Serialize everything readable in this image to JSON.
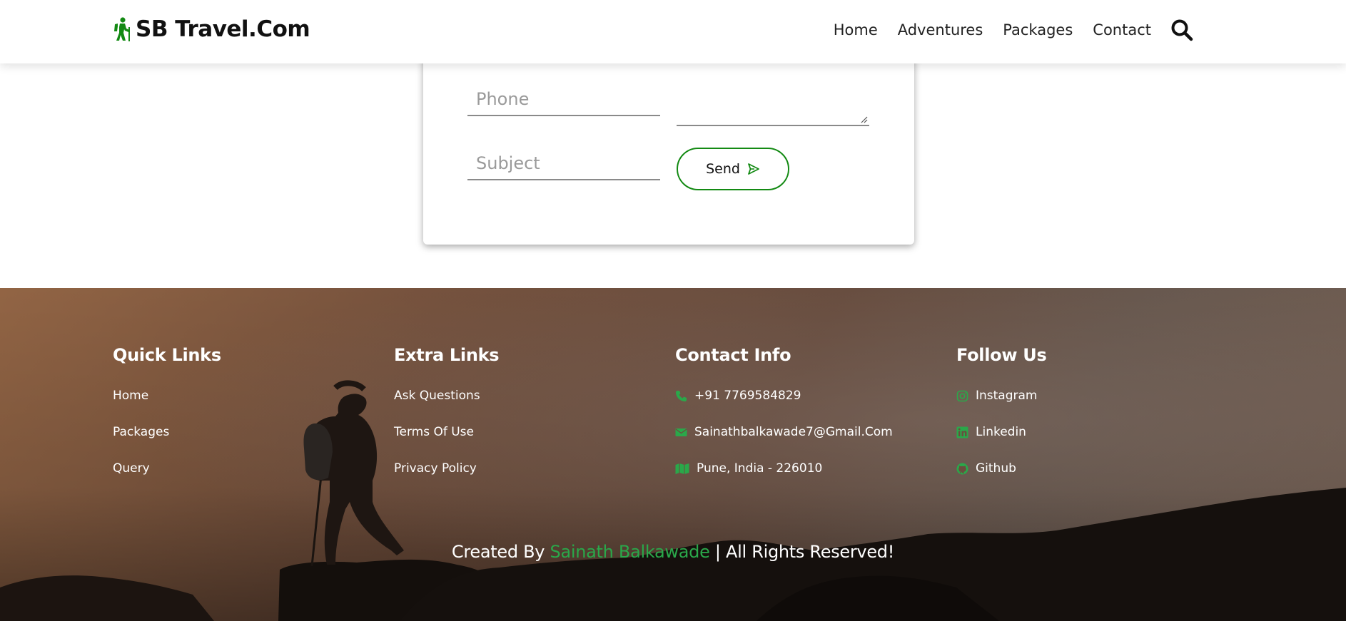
{
  "colors": {
    "brand_green": "#138a13",
    "accent_green": "#2aa84a",
    "text_dark": "#111111",
    "footer_text": "#ffffff"
  },
  "header": {
    "logo_icon": "hiker-icon",
    "logo_text": "SB Travel.Com",
    "nav": [
      "Home",
      "Adventures",
      "Packages",
      "Contact"
    ],
    "search_icon": "search-icon"
  },
  "form": {
    "phone_placeholder": "Phone",
    "subject_placeholder": "Subject",
    "message_value": "",
    "send_label": "Send",
    "send_icon": "paper-plane-icon"
  },
  "footer": {
    "quick_links": {
      "title": "Quick Links",
      "items": [
        "Home",
        "Packages",
        "Query"
      ]
    },
    "extra_links": {
      "title": "Extra Links",
      "items": [
        "Ask Questions",
        "Terms Of Use",
        "Privacy Policy"
      ]
    },
    "contact_info": {
      "title": "Contact Info",
      "items": [
        {
          "icon": "phone-icon",
          "text": "+91 7769584829"
        },
        {
          "icon": "envelope-icon",
          "text": "Sainathbalkawade7@Gmail.Com"
        },
        {
          "icon": "map-icon",
          "text": "Pune, India - 226010"
        }
      ]
    },
    "follow_us": {
      "title": "Follow Us",
      "items": [
        {
          "icon": "instagram-icon",
          "text": "Instagram"
        },
        {
          "icon": "linkedin-icon",
          "text": "Linkedin"
        },
        {
          "icon": "github-icon",
          "text": "Github"
        }
      ]
    },
    "credit": {
      "prefix": "Created By ",
      "author": "Sainath Balkawade",
      "suffix": " | All Rights Reserved!"
    }
  }
}
